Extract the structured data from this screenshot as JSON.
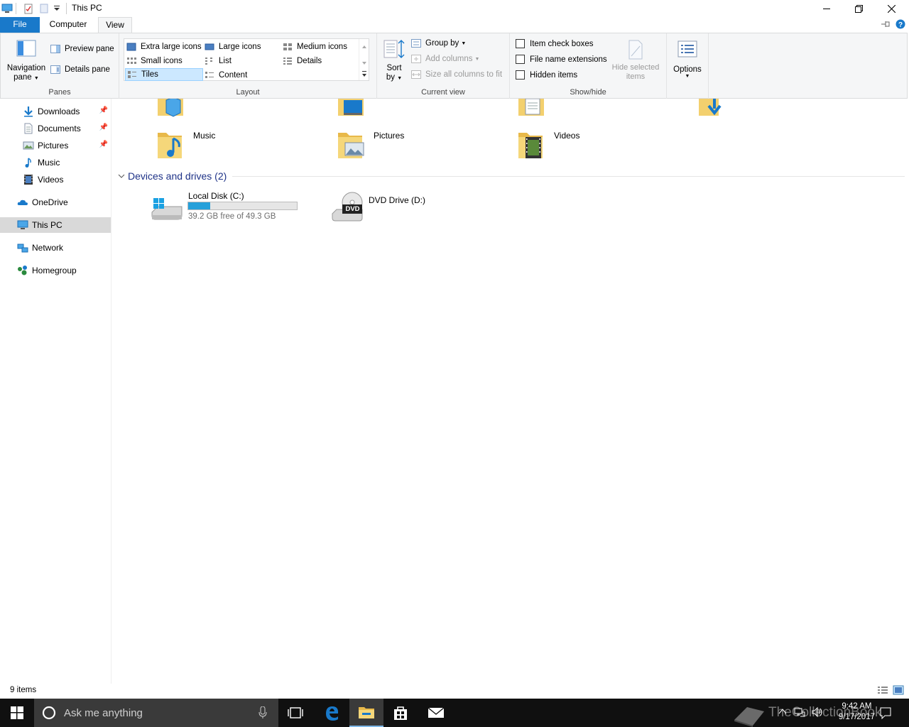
{
  "window": {
    "title": "This PC"
  },
  "tabs": {
    "file": "File",
    "computer": "Computer",
    "view": "View"
  },
  "ribbon": {
    "panes": {
      "label": "Panes",
      "navigation_pane": "Navigation pane",
      "navigation_pane_line1": "Navigation",
      "navigation_pane_line2": "pane",
      "preview_pane": "Preview pane",
      "details_pane": "Details pane"
    },
    "layout": {
      "label": "Layout",
      "items": [
        "Extra large icons",
        "Large icons",
        "Medium icons",
        "Small icons",
        "List",
        "Details",
        "Tiles",
        "Content"
      ],
      "selected": "Tiles"
    },
    "current_view": {
      "label": "Current view",
      "sort_line1": "Sort",
      "sort_line2": "by",
      "group_by": "Group by",
      "add_columns": "Add columns",
      "size_columns": "Size all columns to fit"
    },
    "show_hide": {
      "label": "Show/hide",
      "item_check_boxes": "Item check boxes",
      "file_name_extensions": "File name extensions",
      "hidden_items": "Hidden items",
      "hide_selected_line1": "Hide selected",
      "hide_selected_line2": "items"
    },
    "options": "Options"
  },
  "nav": {
    "items": [
      {
        "label": "Downloads",
        "icon": "download-arrow-icon",
        "pinned": true
      },
      {
        "label": "Documents",
        "icon": "documents-icon",
        "pinned": true
      },
      {
        "label": "Pictures",
        "icon": "pictures-icon",
        "pinned": true
      },
      {
        "label": "Music",
        "icon": "music-note-icon",
        "pinned": false
      },
      {
        "label": "Videos",
        "icon": "videos-icon",
        "pinned": false
      }
    ],
    "onedrive": "OneDrive",
    "this_pc": "This PC",
    "network": "Network",
    "homegroup": "Homegroup"
  },
  "content": {
    "folders": [
      "Music",
      "Pictures",
      "Videos"
    ],
    "devices_header": "Devices and drives (2)",
    "drives": [
      {
        "name": "Local Disk (C:)",
        "free_text": "39.2 GB free of 49.3 GB",
        "used_fraction": 0.205
      },
      {
        "name": "DVD Drive (D:)",
        "badge": "DVD"
      }
    ]
  },
  "status": {
    "item_count": "9 items"
  },
  "taskbar": {
    "search_placeholder": "Ask me anything",
    "time": "9:42 AM",
    "date": "9/17/2017",
    "watermark": "TheCollectionBook"
  },
  "colors": {
    "accent": "#1979ca",
    "drive_bar": "#26a0da",
    "taskbar": "#101010",
    "selection": "#cce8ff"
  }
}
